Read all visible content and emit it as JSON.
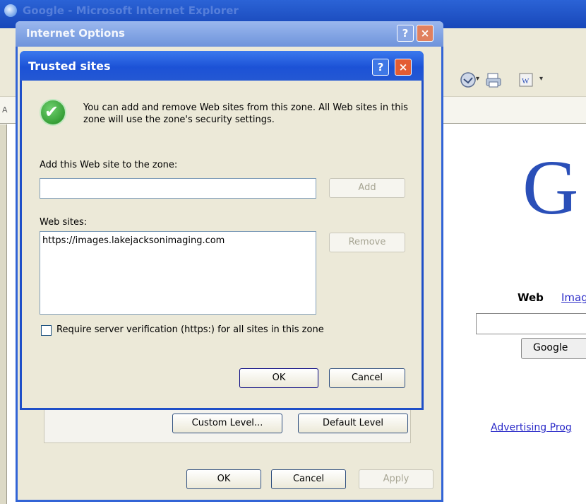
{
  "background_window": {
    "title": "Google - Microsoft Internet Explorer",
    "address_letter": "A",
    "google_logo_letter": "G",
    "google_tabs": [
      "Web",
      "Imag"
    ],
    "google_button": "Google",
    "advertising_link": "Advertising Prog"
  },
  "internet_options": {
    "title": "Internet Options",
    "help_button": "?",
    "close_button": "×",
    "custom_level_button": "Custom Level...",
    "default_level_button": "Default Level",
    "ok_button": "OK",
    "cancel_button": "Cancel",
    "apply_button": "Apply"
  },
  "trusted_sites": {
    "title": "Trusted sites",
    "help_button": "?",
    "close_button": "×",
    "info_text": "You can add and remove Web sites from this zone. All Web sites in this zone will use the zone's security settings.",
    "add_label": "Add this Web site to the zone:",
    "add_input_value": "",
    "add_button": "Add",
    "sites_label": "Web sites:",
    "sites": [
      "https://images.lakejacksonimaging.com"
    ],
    "remove_button": "Remove",
    "require_verification_label": "Require server verification (https:) for all sites in this zone",
    "require_verification_checked": false,
    "ok_button": "OK",
    "cancel_button": "Cancel"
  },
  "colors": {
    "title_bar_active": "#1c52d6",
    "dialog_face": "#ece9d8",
    "close_button": "#e35c34",
    "check_icon": "#1e8a1e"
  }
}
